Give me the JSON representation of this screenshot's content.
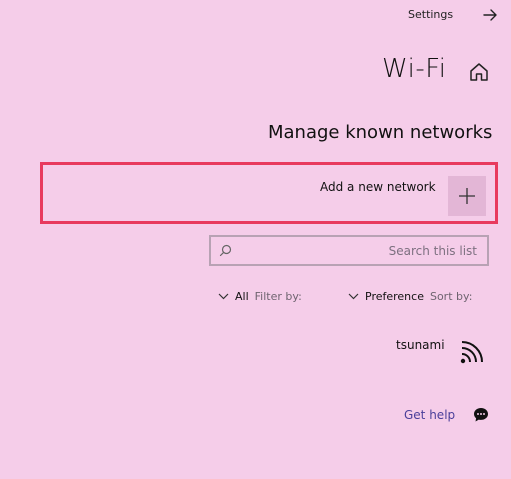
{
  "nav": {
    "back_label": "Settings"
  },
  "header": {
    "title": "Wi-Fi"
  },
  "section": {
    "title": "Manage known networks"
  },
  "add_network": {
    "label": "Add a new network",
    "highlight_color": "#e83a5e"
  },
  "search": {
    "placeholder": "Search this list",
    "value": ""
  },
  "sort": {
    "label": "Sort by:",
    "value": "Preference"
  },
  "filter": {
    "label": "Filter by:",
    "value": "All"
  },
  "networks": [
    {
      "name": "tsunami",
      "icon": "wifi-signal-icon"
    }
  ],
  "help": {
    "label": "Get help",
    "link_color": "#4a3f9a"
  },
  "theme": {
    "background": "#f5cde9",
    "button_background": "#e3b6d6"
  }
}
